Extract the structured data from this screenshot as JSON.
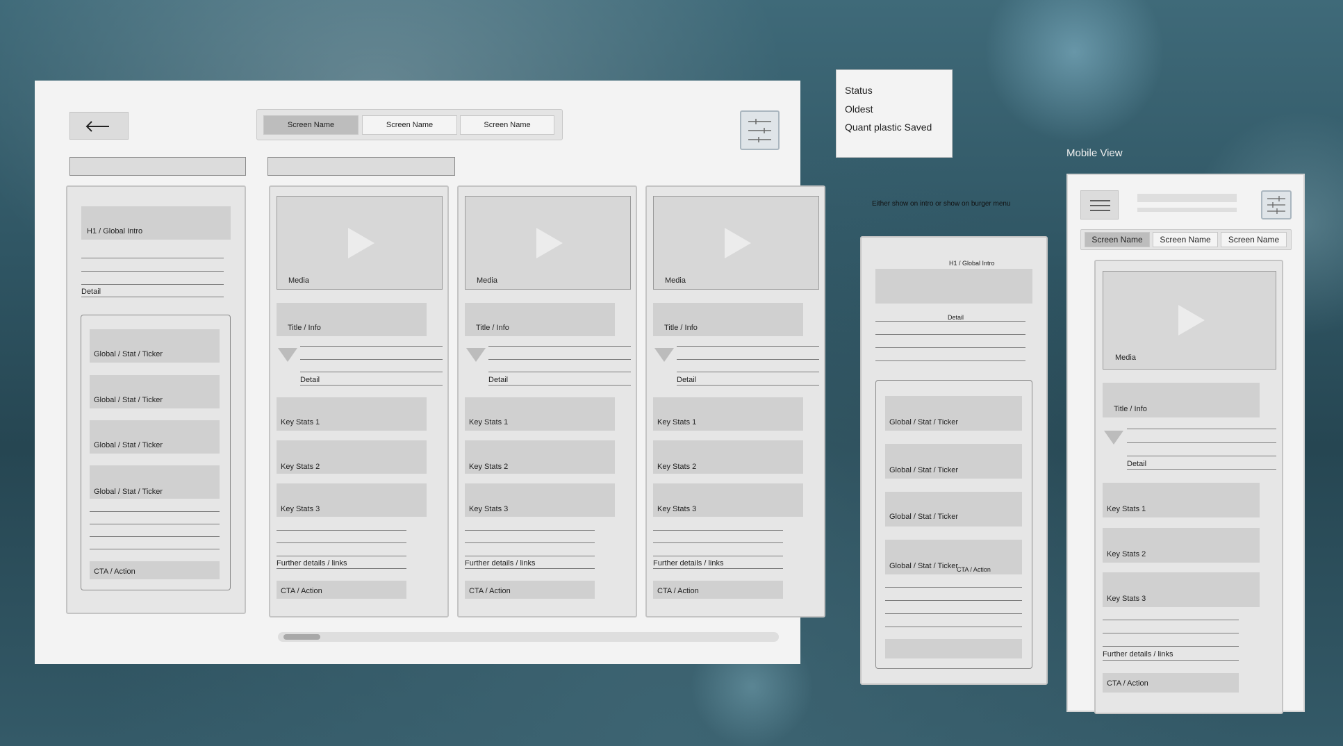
{
  "desktop": {
    "tabs": [
      "Screen Name",
      "Screen Name",
      "Screen Name"
    ],
    "intro": {
      "title": "H1 / Global Intro",
      "detail": "Detail",
      "tickers": [
        "Global / Stat / Ticker",
        "Global / Stat / Ticker",
        "Global / Stat / Ticker",
        "Global / Stat / Ticker"
      ],
      "cta": "CTA / Action"
    },
    "cards": [
      {
        "media": "Media",
        "title": "Title / Info",
        "detail": "Detail",
        "stats": [
          "Key Stats 1",
          "Key Stats 2",
          "Key Stats 3"
        ],
        "further": "Further details / links",
        "cta": "CTA / Action"
      },
      {
        "media": "Media",
        "title": "Title / Info",
        "detail": "Detail",
        "stats": [
          "Key Stats 1",
          "Key Stats 2",
          "Key Stats 3"
        ],
        "further": "Further details / links",
        "cta": "CTA / Action"
      },
      {
        "media": "Media",
        "title": "Title / Info",
        "detail": "Detail",
        "stats": [
          "Key Stats 1",
          "Key Stats 2",
          "Key Stats 3"
        ],
        "further": "Further details / links",
        "cta": "CTA / Action"
      }
    ]
  },
  "filter_dropdown": {
    "options": [
      "Status",
      "Oldest",
      "Quant plastic Saved"
    ]
  },
  "note": {
    "text": "Either show on intro or show on burger menu",
    "title": "H1 / Global Intro",
    "detail": "Detail",
    "tickers": [
      "Global / Stat / Ticker",
      "Global / Stat / Ticker",
      "Global / Stat / Ticker",
      "Global / Stat / Ticker"
    ],
    "cta": "CTA / Action"
  },
  "mobile": {
    "heading": "Mobile View",
    "tabs": [
      "Screen Name",
      "Screen Name",
      "Screen Name"
    ],
    "card": {
      "media": "Media",
      "title": "Title / Info",
      "detail": "Detail",
      "stats": [
        "Key Stats 1",
        "Key Stats 2",
        "Key Stats 3"
      ],
      "further": "Further details / links",
      "cta": "CTA / Action"
    }
  }
}
